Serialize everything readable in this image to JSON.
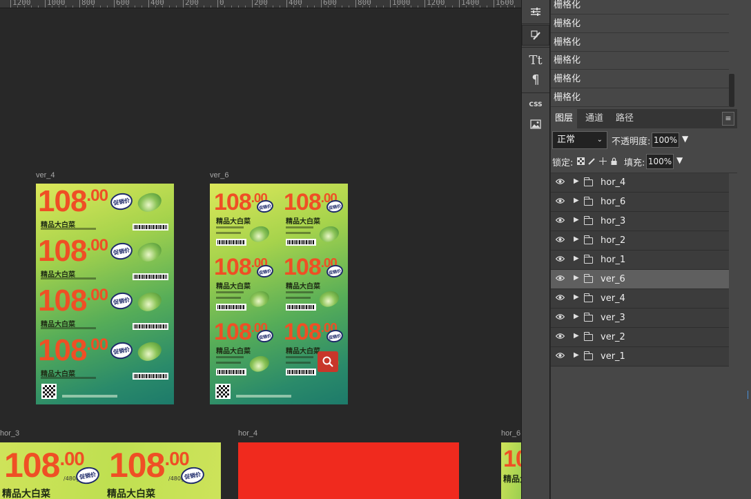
{
  "ruler": {
    "labels": [
      "1200",
      "1000",
      "800",
      "600",
      "400",
      "200",
      "0",
      "200",
      "400",
      "600",
      "800",
      "1000",
      "1200",
      "1400",
      "1600"
    ]
  },
  "artboards": {
    "ver_4": {
      "label": "ver_4",
      "rows": [
        {
          "price": "108",
          "dec": ".00",
          "name": "精品大白菜",
          "badge": "促销价"
        },
        {
          "price": "108",
          "dec": ".00",
          "name": "精品大白菜",
          "badge": "促销价"
        },
        {
          "price": "108",
          "dec": ".00",
          "name": "精品大白菜",
          "badge": "促销价"
        },
        {
          "price": "108",
          "dec": ".00",
          "name": "精品大白菜",
          "badge": "促销价"
        }
      ]
    },
    "ver_6": {
      "label": "ver_6",
      "cells": [
        {
          "price": "108",
          "dec": ".00",
          "name": "精品大白菜",
          "badge": "促销价"
        },
        {
          "price": "108",
          "dec": ".00",
          "name": "精品大白菜",
          "badge": "促销价"
        },
        {
          "price": "108",
          "dec": ".00",
          "name": "精品大白菜",
          "badge": "促销价"
        },
        {
          "price": "108",
          "dec": ".00",
          "name": "精品大白菜",
          "badge": "促销价"
        },
        {
          "price": "108",
          "dec": ".00",
          "name": "精品大白菜",
          "badge": "促销价"
        },
        {
          "price": "108",
          "dec": ".00",
          "name": "精品大白菜",
          "badge": "促销价"
        }
      ]
    },
    "hor_3": {
      "label": "hor_3",
      "cells": [
        {
          "price": "108",
          "dec": ".00",
          "unit": "/480g",
          "name": "精品大白菜",
          "badge": "促销价"
        },
        {
          "price": "108",
          "dec": ".00",
          "unit": "/480g",
          "name": "精品大白菜",
          "badge": "促销价"
        }
      ]
    },
    "hor_4": {
      "label": "hor_4"
    },
    "hor_6": {
      "label": "hor_6",
      "price": "10",
      "name": "精品大白"
    }
  },
  "toolstrip": {
    "icons": [
      "sliders-icon",
      "brush-icon",
      "text-icon",
      "paragraph-icon",
      "css-icon",
      "image-icon"
    ],
    "text_glyph": "Tt",
    "paragraph_glyph": "¶",
    "css_label": "CSS"
  },
  "history": {
    "items": [
      "栅格化",
      "栅格化",
      "栅格化",
      "栅格化",
      "栅格化",
      "栅格化"
    ]
  },
  "layers_panel": {
    "tabs": [
      "图层",
      "通道",
      "路径"
    ],
    "active_tab": "图层",
    "menu_glyph": "≡",
    "blend_mode": "正常",
    "opacity_label": "不透明度:",
    "opacity_value": "100%",
    "lock_label": "锁定:",
    "fill_label": "填充:",
    "fill_value": "100%",
    "layers": [
      {
        "name": "hor_4",
        "selected": false
      },
      {
        "name": "hor_6",
        "selected": false
      },
      {
        "name": "hor_3",
        "selected": false
      },
      {
        "name": "hor_2",
        "selected": false
      },
      {
        "name": "hor_1",
        "selected": false
      },
      {
        "name": "ver_6",
        "selected": true
      },
      {
        "name": "ver_4",
        "selected": false
      },
      {
        "name": "ver_3",
        "selected": false
      },
      {
        "name": "ver_2",
        "selected": false
      },
      {
        "name": "ver_1",
        "selected": false
      }
    ]
  },
  "colors": {
    "canvas_bg": "#282828",
    "panel_bg": "#474747",
    "selected_layer": "#5f5f5f",
    "price_orange": "#ef4f25",
    "red_artboard": "#f02a1e"
  }
}
